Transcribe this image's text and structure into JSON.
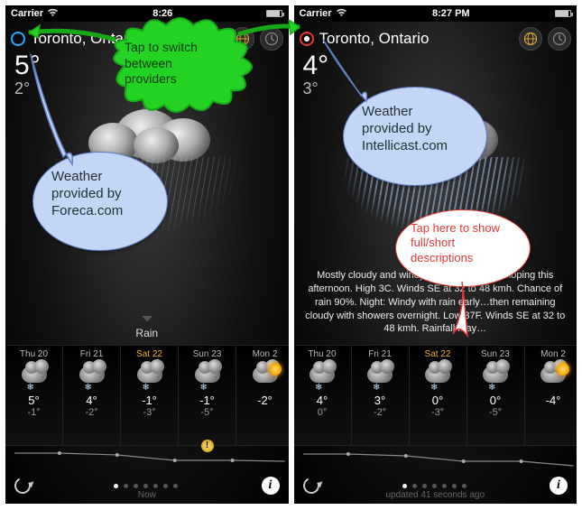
{
  "status": {
    "carrier": "Carrier",
    "time_left": "8:26",
    "time_right": "8:27 PM"
  },
  "left_phone": {
    "provider_color": "#2aa7ff",
    "location": "Toronto, Ontario",
    "temp_now": "5°",
    "temp_low": "2°",
    "condition_label": "Rain",
    "footer_center": "Now",
    "forecast": [
      {
        "label": "Thu 20",
        "hi": "5°",
        "lo": "-1°",
        "active": false,
        "icon": "cloud-snow"
      },
      {
        "label": "Fri 21",
        "hi": "4°",
        "lo": "-2°",
        "active": false,
        "icon": "cloud-snow"
      },
      {
        "label": "Sat 22",
        "hi": "-1°",
        "lo": "-3°",
        "active": true,
        "icon": "cloud-snow"
      },
      {
        "label": "Sun 23",
        "hi": "-1°",
        "lo": "-5°",
        "active": false,
        "icon": "cloud-snow",
        "warn": true
      },
      {
        "label": "Mon 2",
        "hi": "-2°",
        "lo": "",
        "active": false,
        "icon": "sun-cloud"
      }
    ]
  },
  "right_phone": {
    "provider_color": "#e63434",
    "location": "Toronto, Ontario",
    "temp_now": "4°",
    "temp_low": "3°",
    "description": "Mostly cloudy and windy with showers developing this afternoon. High 3C. Winds SE at 32 to 48 kmh. Chance of rain 90%. Night: Windy with rain early…then remaining cloudy with showers overnight. Low 37F. Winds SE at 32 to 48 kmh. Rainfall may…",
    "footer_center": "updated 41 seconds ago",
    "forecast": [
      {
        "label": "Thu 20",
        "hi": "4°",
        "lo": "0°",
        "active": false,
        "icon": "cloud-snow"
      },
      {
        "label": "Fri 21",
        "hi": "3°",
        "lo": "-2°",
        "active": false,
        "icon": "cloud-snow"
      },
      {
        "label": "Sat 22",
        "hi": "0°",
        "lo": "-3°",
        "active": true,
        "icon": "cloud-snow"
      },
      {
        "label": "Sun 23",
        "hi": "0°",
        "lo": "-5°",
        "active": false,
        "icon": "cloud-snow"
      },
      {
        "label": "Mon 2",
        "hi": "-4°",
        "lo": "",
        "active": false,
        "icon": "sun-cloud"
      }
    ]
  },
  "annotations": {
    "switch_providers": "Tap to switch between providers",
    "foreca": "Weather provided by Foreca.com",
    "intellicast": "Weather provided by Intellicast.com",
    "descriptions": "Tap here to show full/short descriptions"
  }
}
